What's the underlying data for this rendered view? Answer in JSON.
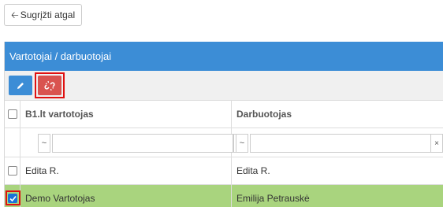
{
  "back_button": {
    "label": "Sugrįžti atgal",
    "icon": "arrow-left-icon"
  },
  "panel": {
    "title": "Vartotojai / darbuotojai",
    "header_color": "#3c8dd6",
    "toolbar": {
      "edit_icon": "pencil-icon",
      "unlink_icon": "unlink-icon"
    }
  },
  "grid": {
    "columns": [
      "B1.lt vartotojas",
      "Darbuotojas"
    ],
    "filter": {
      "operator": "~",
      "clear": "×"
    },
    "rows": [
      {
        "user": "Edita R.",
        "employee": "Edita R.",
        "selected": false
      },
      {
        "user": "Demo Vartotojas",
        "employee": "Emilija Petrauskė",
        "selected": true
      }
    ]
  },
  "colors": {
    "accent": "#3c8dd6",
    "danger": "#d9534f",
    "highlight": "#e01010",
    "selected_row": "#a9d47e"
  }
}
